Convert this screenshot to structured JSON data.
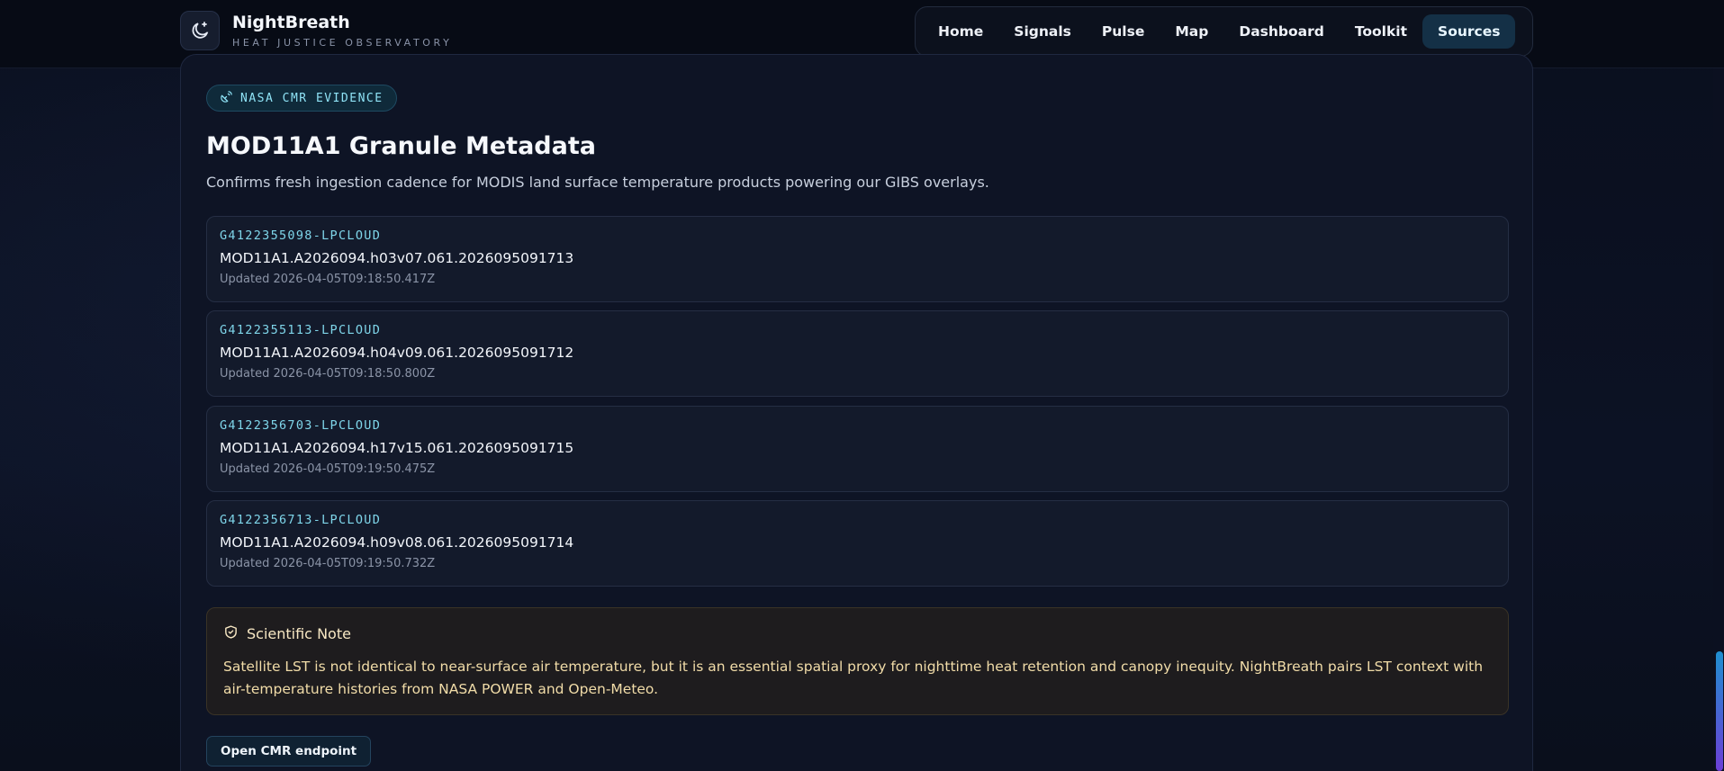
{
  "brand": {
    "name": "NightBreath",
    "tagline": "HEAT JUSTICE OBSERVATORY",
    "logo_icon": "moon-plus-icon"
  },
  "nav": {
    "items": [
      {
        "label": "Home"
      },
      {
        "label": "Signals"
      },
      {
        "label": "Pulse"
      },
      {
        "label": "Map"
      },
      {
        "label": "Dashboard"
      },
      {
        "label": "Toolkit"
      },
      {
        "label": "Sources",
        "active": true
      }
    ]
  },
  "card": {
    "badge": "NASA CMR EVIDENCE",
    "badge_icon": "satellite-icon",
    "title": "MOD11A1 Granule Metadata",
    "subtitle": "Confirms fresh ingestion cadence for MODIS land surface temperature products powering our GIBS overlays.",
    "granules": [
      {
        "id": "G4122355098-LPCLOUD",
        "name": "MOD11A1.A2026094.h03v07.061.2026095091713",
        "updated": "Updated 2026-04-05T09:18:50.417Z"
      },
      {
        "id": "G4122355113-LPCLOUD",
        "name": "MOD11A1.A2026094.h04v09.061.2026095091712",
        "updated": "Updated 2026-04-05T09:18:50.800Z"
      },
      {
        "id": "G4122356703-LPCLOUD",
        "name": "MOD11A1.A2026094.h17v15.061.2026095091715",
        "updated": "Updated 2026-04-05T09:19:50.475Z"
      },
      {
        "id": "G4122356713-LPCLOUD",
        "name": "MOD11A1.A2026094.h09v08.061.2026095091714",
        "updated": "Updated 2026-04-05T09:19:50.732Z"
      }
    ],
    "note": {
      "icon": "shield-check-icon",
      "title": "Scientific Note",
      "body": "Satellite LST is not identical to near-surface air temperature, but it is an essential spatial proxy for nighttime heat retention and canopy inequity. NightBreath pairs LST context with air-temperature histories from NASA POWER and Open-Meteo."
    },
    "open_button": "Open CMR endpoint"
  },
  "colors": {
    "accent": "#7fd6ea",
    "background": "#0b1020",
    "note_text": "#f1dca8"
  }
}
